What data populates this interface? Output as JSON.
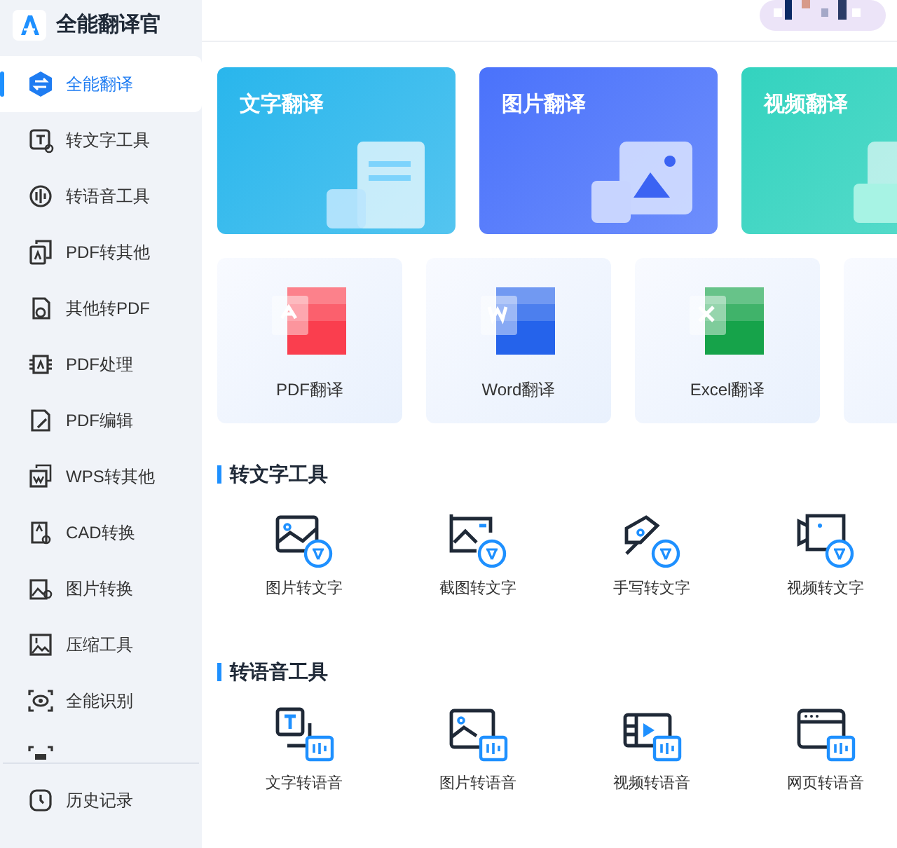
{
  "app": {
    "title": "全能翻译官"
  },
  "sidebar": {
    "items": [
      {
        "label": "全能翻译",
        "selected": true
      },
      {
        "label": "转文字工具",
        "selected": false
      },
      {
        "label": "转语音工具",
        "selected": false
      },
      {
        "label": "PDF转其他",
        "selected": false
      },
      {
        "label": "其他转PDF",
        "selected": false
      },
      {
        "label": "PDF处理",
        "selected": false
      },
      {
        "label": "PDF编辑",
        "selected": false
      },
      {
        "label": "WPS转其他",
        "selected": false
      },
      {
        "label": "CAD转换",
        "selected": false
      },
      {
        "label": "图片转换",
        "selected": false
      },
      {
        "label": "压缩工具",
        "selected": false
      },
      {
        "label": "全能识别",
        "selected": false
      },
      {
        "selected": false
      }
    ],
    "footer": {
      "label": "历史记录"
    }
  },
  "feature_cards": [
    {
      "title": "文字翻译",
      "color": "#29b6ec"
    },
    {
      "title": "图片翻译",
      "color": "#4a72fb"
    },
    {
      "title": "视频翻译",
      "color": "#33d3bf"
    }
  ],
  "doc_cards": [
    {
      "label": "PDF翻译",
      "kind": "pdf"
    },
    {
      "label": "Word翻译",
      "kind": "word"
    },
    {
      "label": "Excel翻译",
      "kind": "excel"
    },
    {
      "kind": "more"
    }
  ],
  "sections": [
    {
      "title": "转文字工具",
      "tools": [
        {
          "label": "图片转文字"
        },
        {
          "label": "截图转文字"
        },
        {
          "label": "手写转文字"
        },
        {
          "label": "视频转文字"
        }
      ]
    },
    {
      "title": "转语音工具",
      "tools": [
        {
          "label": "文字转语音"
        },
        {
          "label": "图片转语音"
        },
        {
          "label": "视频转语音"
        },
        {
          "label": "网页转语音"
        }
      ]
    }
  ]
}
